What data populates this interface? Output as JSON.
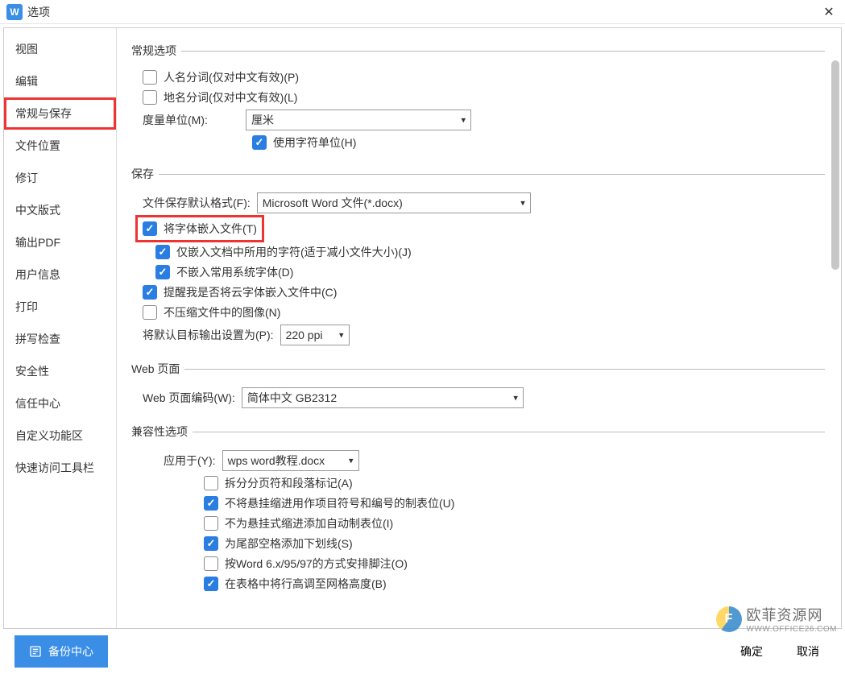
{
  "window": {
    "title": "选项"
  },
  "sidebar": {
    "items": [
      "视图",
      "编辑",
      "常规与保存",
      "文件位置",
      "修订",
      "中文版式",
      "输出PDF",
      "用户信息",
      "打印",
      "拼写检查",
      "安全性",
      "信任中心",
      "自定义功能区",
      "快速访问工具栏"
    ],
    "selectedIndex": 2
  },
  "groups": {
    "general": {
      "legend": "常规选项",
      "personName": "人名分词(仅对中文有效)(P)",
      "placeName": "地名分词(仅对中文有效)(L)",
      "unitLabel": "度量单位(M):",
      "unitValue": "厘米",
      "useCharUnit": "使用字符单位(H)"
    },
    "save": {
      "legend": "保存",
      "formatLabel": "文件保存默认格式(F):",
      "formatValue": "Microsoft Word 文件(*.docx)",
      "embedFont": "将字体嵌入文件(T)",
      "embedUsed": "仅嵌入文档中所用的字符(适于减小文件大小)(J)",
      "notCommon": "不嵌入常用系统字体(D)",
      "remindCloud": "提醒我是否将云字体嵌入文件中(C)",
      "noCompress": "不压缩文件中的图像(N)",
      "targetLabel": "将默认目标输出设置为(P):",
      "ppiValue": "220 ppi"
    },
    "web": {
      "legend": "Web 页面",
      "encLabel": "Web 页面编码(W):",
      "encValue": "简体中文 GB2312"
    },
    "compat": {
      "legend": "兼容性选项",
      "applyLabel": "应用于(Y):",
      "fileValue": "wps word教程.docx",
      "splitPage": "拆分分页符和段落标记(A)",
      "noHangTab": "不将悬挂缩进用作项目符号和编号的制表位(U)",
      "noAutoTab": "不为悬挂式缩进添加自动制表位(I)",
      "underlineTrail": "为尾部空格添加下划线(S)",
      "word6": "按Word 6.x/95/97的方式安排脚注(O)",
      "rowHeight": "在表格中将行高调至网格高度(B)"
    }
  },
  "footer": {
    "backup": "备份中心",
    "ok": "确定",
    "cancel": "取消"
  },
  "watermark": {
    "text": "欧菲资源网",
    "sub": "WWW.OFFICE26.COM"
  }
}
